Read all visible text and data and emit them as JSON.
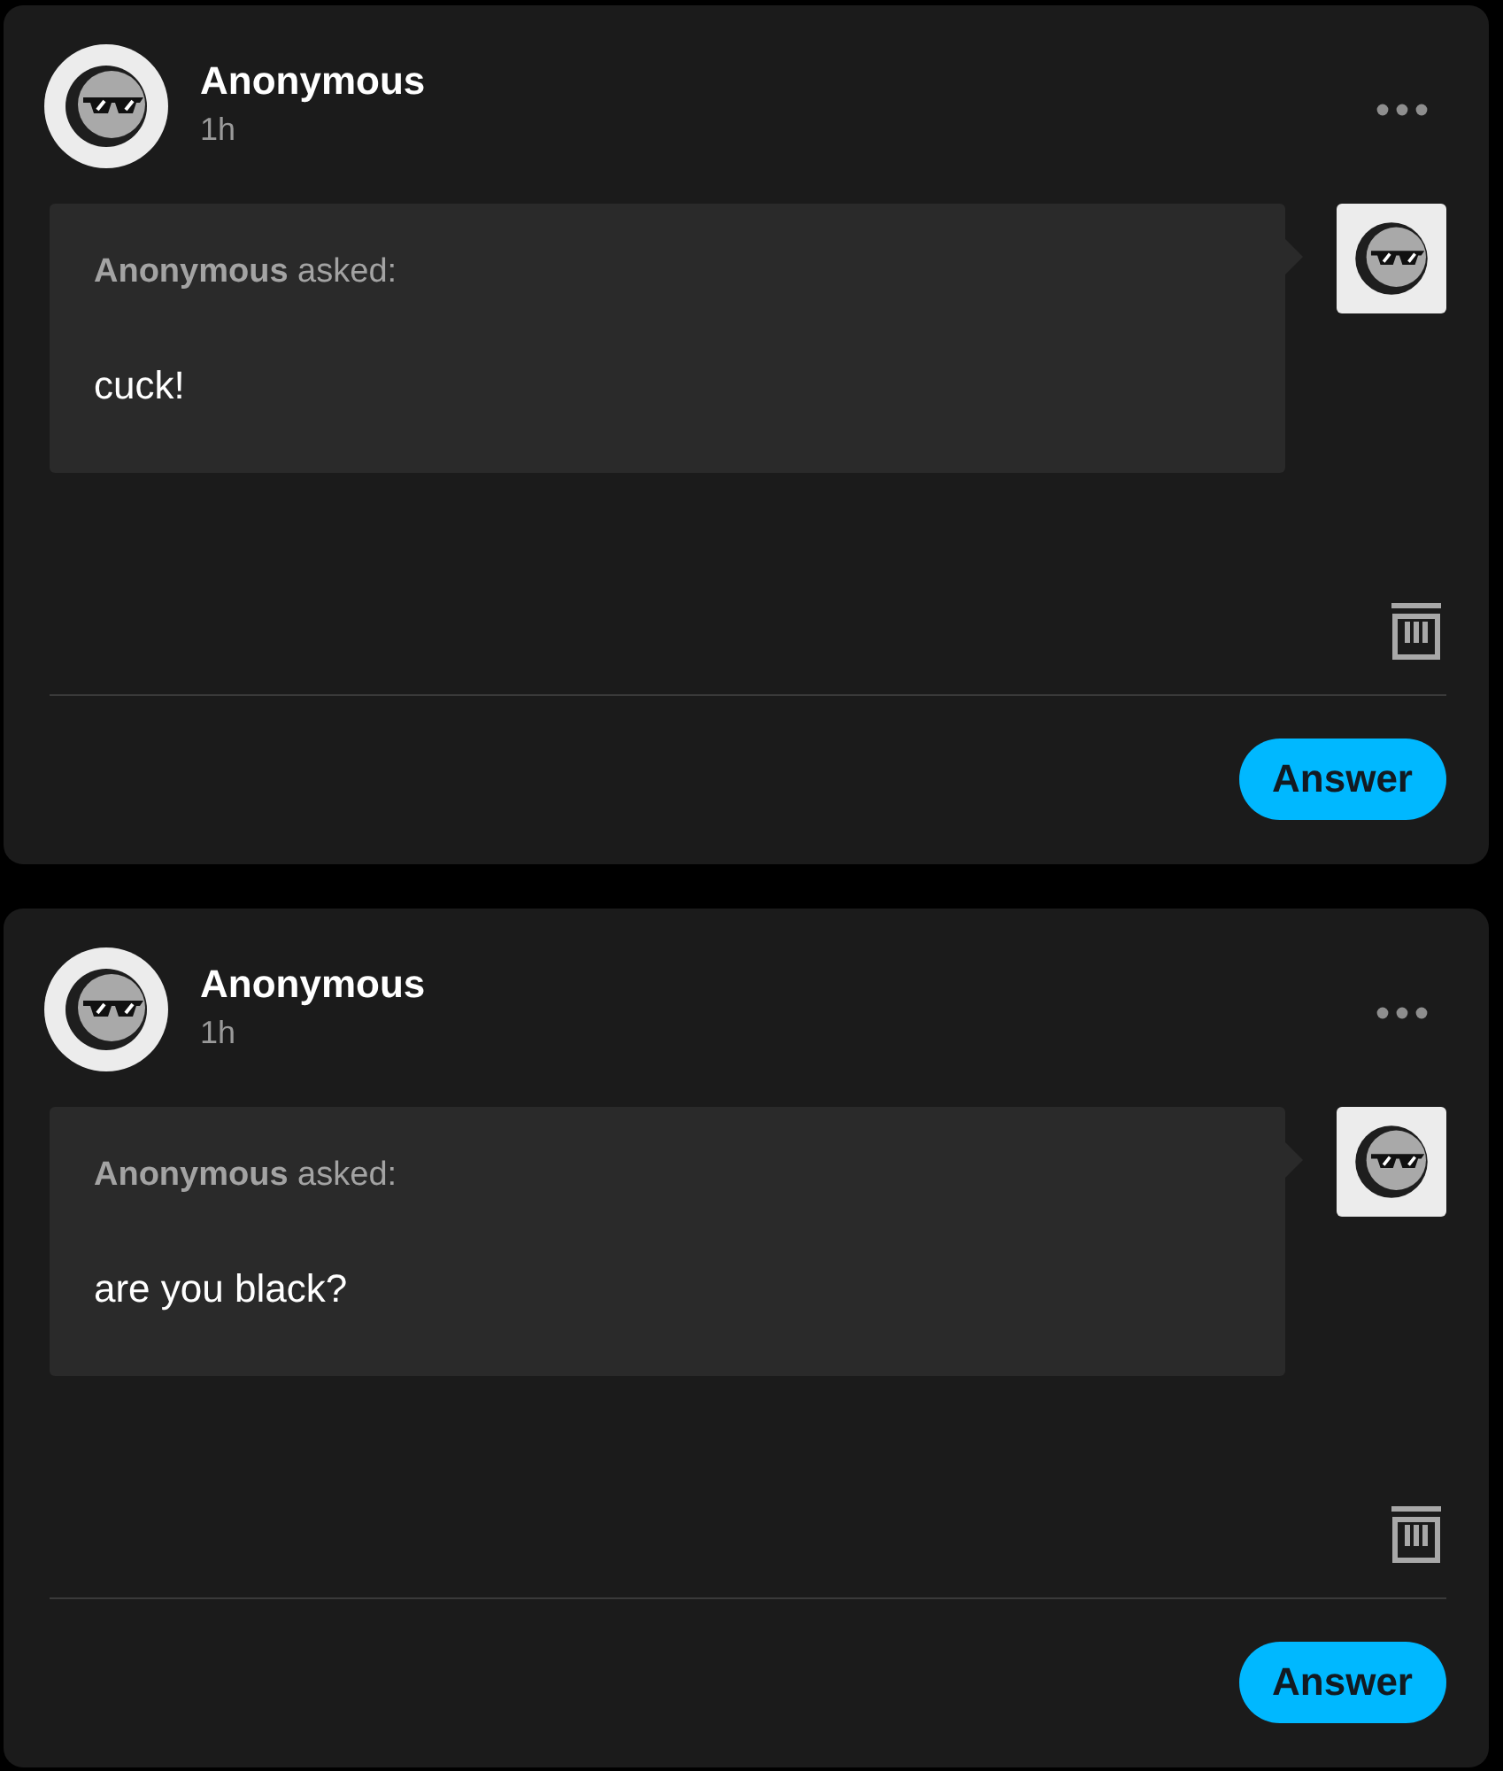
{
  "posts": [
    {
      "author": "Anonymous",
      "time": "1h",
      "ask_line": "**Anonymous** asked:",
      "question": "cuck!",
      "answer_button": "Answer"
    },
    {
      "author": "Anonymous",
      "time": "1h",
      "ask_line": "**Anonymous** asked:",
      "question": "are you black?",
      "answer_button": "Answer"
    }
  ]
}
